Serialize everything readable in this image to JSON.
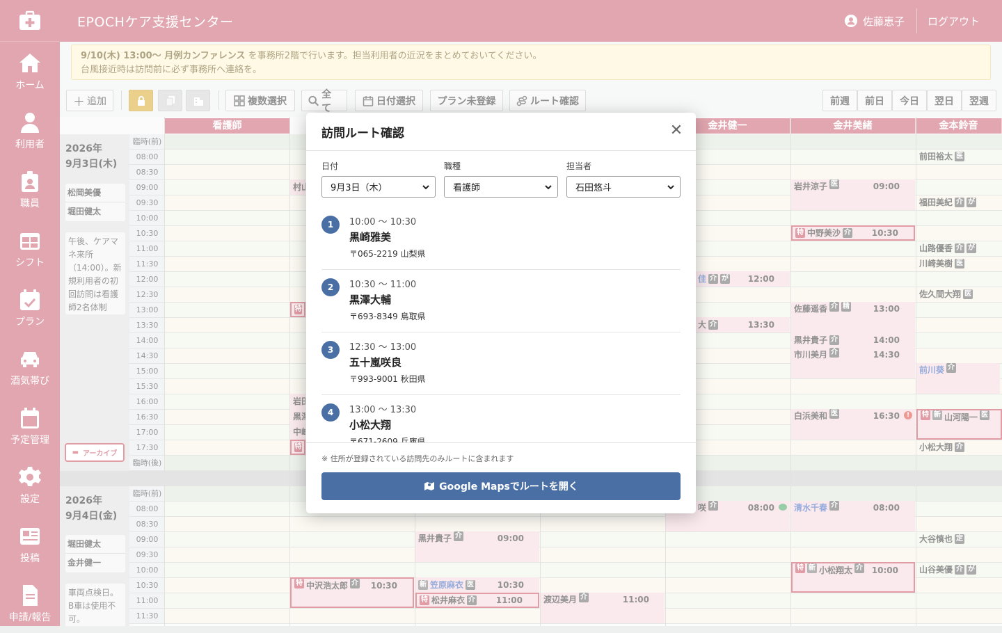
{
  "app": {
    "title": "EPOCHケア支援センター",
    "user": "佐藤恵子",
    "logout": "ログアウト"
  },
  "nav": [
    {
      "label": "ホーム",
      "icon": "home-icon"
    },
    {
      "label": "利用者",
      "icon": "person-icon"
    },
    {
      "label": "職員",
      "icon": "badge-icon"
    },
    {
      "label": "シフト",
      "icon": "table-icon"
    },
    {
      "label": "プラン",
      "icon": "calendar-check-icon"
    },
    {
      "label": "酒気帯び",
      "icon": "car-icon"
    },
    {
      "label": "予定管理",
      "icon": "calendar-icon"
    },
    {
      "label": "設定",
      "icon": "gear-icon"
    },
    {
      "label": "投稿",
      "icon": "newspaper-icon"
    },
    {
      "label": "申請/報告",
      "icon": "document-icon"
    }
  ],
  "notice": {
    "bold": "9/10(木) 13:00〜 月例カンファレンス",
    "line1": "を事務所2階で行います。担当利用者の近況をまとめておいてください。",
    "line2": "台風接近時は訪問前に必ず事務所へ連絡を。"
  },
  "toolbar": {
    "add": "追加",
    "multi_select": "複数選択",
    "all": "全て",
    "date_select": "日付選択",
    "plan_unregistered": "プラン未登録",
    "route_check": "ルート確認",
    "prev_week": "前週",
    "prev_day": "前日",
    "today": "今日",
    "next_day": "翌日",
    "next_week": "翌週"
  },
  "schedule": {
    "columns": [
      "看護師",
      "金井健一",
      "金井美緒",
      "金本鈴音"
    ],
    "day1": {
      "date_line1": "2026年",
      "date_line2": "9月3日(木)",
      "staff": [
        "松岡美優",
        "堀田健太"
      ],
      "memo": "午後、ケアマネ来所（14:00）。新規利用者の初回訪問は看護師2名体制",
      "archive": "アーカイブ",
      "times": [
        "臨時(前)",
        "08:00",
        "08:30",
        "09:00",
        "09:30",
        "10:00",
        "10:30",
        "11:00",
        "11:30",
        "12:00",
        "12:30",
        "13:00",
        "13:30",
        "14:00",
        "14:30",
        "15:00",
        "15:30",
        "16:00",
        "16:30",
        "17:00",
        "17:30",
        "臨時(後)"
      ]
    },
    "day2": {
      "date_line1": "2026年",
      "date_line2": "9月4日(金)",
      "staff": [
        "堀田健太",
        "金井健一"
      ],
      "memo": "車両点検日。B車は使用不可。",
      "times": [
        "臨時(前)",
        "08:00",
        "08:30",
        "09:00",
        "09:30",
        "10:00",
        "10:30",
        "11:00",
        "11:30"
      ]
    },
    "appointments": [
      {
        "name": "前田裕太",
        "tag": "医",
        "time": ""
      },
      {
        "name": "村山",
        "tag": "",
        "time": ""
      },
      {
        "name": "岩井涼子",
        "tag": "医",
        "time": "09:00"
      },
      {
        "name": "福田美紀",
        "tag": "介",
        "tag2": "が",
        "time": ""
      },
      {
        "name": "中野美沙",
        "tag": "介",
        "time": "10:30",
        "flag": "特"
      },
      {
        "name": "山路優香",
        "tag": "介",
        "tag2": "が",
        "time": ""
      },
      {
        "name": "川崎美樹",
        "tag": "医",
        "time": ""
      },
      {
        "name": "佳",
        "tag": "介",
        "tag2": "が",
        "time": "12:00"
      },
      {
        "name": "佐久間大翔",
        "tag": "医",
        "time": ""
      },
      {
        "name": "佐藤遥香",
        "tag": "介",
        "tag2": "精",
        "time": "13:00"
      },
      {
        "name": "大",
        "tag": "介",
        "time": "13:30"
      },
      {
        "name": "黒井貴子",
        "tag": "介",
        "time": "14:00"
      },
      {
        "name": "市川美月",
        "tag": "介",
        "time": "14:30"
      },
      {
        "name": "前川葵",
        "tag": "介",
        "time": ""
      },
      {
        "name": "岩田",
        "tag": "",
        "time": ""
      },
      {
        "name": "黒澤",
        "tag": "",
        "time": ""
      },
      {
        "name": "白浜美和",
        "tag": "医",
        "time": "16:30"
      },
      {
        "name": "山河陽一",
        "tag": "医",
        "time": "",
        "flag": "特",
        "flag2": "新"
      },
      {
        "name": "中峰",
        "tag": "",
        "time": ""
      },
      {
        "name": "小松大翔",
        "tag": "介",
        "time": ""
      },
      {
        "name": "咲",
        "tag": "介",
        "time": "08:00"
      },
      {
        "name": "清水千春",
        "tag": "介",
        "time": "08:00"
      },
      {
        "name": "黒井貴子",
        "tag": "介",
        "time": "09:00"
      },
      {
        "name": "大谷慎也",
        "tag": "定",
        "time": ""
      },
      {
        "name": "小松翔太",
        "tag": "介",
        "time": "10:00",
        "flag": "特",
        "flag2": "新"
      },
      {
        "name": "山谷美優",
        "tag": "介",
        "tag2": "が",
        "time": ""
      },
      {
        "name": "中沢浩太郎",
        "tag": "介",
        "time": "10:30",
        "flag": "特"
      },
      {
        "name": "笠原麻衣",
        "tag": "医",
        "time": "10:30",
        "flag": "新"
      },
      {
        "name": "松井麻衣",
        "tag": "介",
        "time": "11:00",
        "flag": "特"
      },
      {
        "name": "渡辺美月",
        "tag": "介",
        "time": "11:00"
      }
    ]
  },
  "modal": {
    "title": "訪問ルート確認",
    "date_label": "日付",
    "date_value": "9月3日（木）",
    "job_label": "職種",
    "job_value": "看護師",
    "staff_label": "担当者",
    "staff_value": "石田悠斗",
    "routes": [
      {
        "num": "1",
        "time": "10:00 〜 10:30",
        "name": "黒崎雅美",
        "address": "〒065-2219 山梨県"
      },
      {
        "num": "2",
        "time": "10:30 〜 11:00",
        "name": "黒澤大輔",
        "address": "〒693-8349 鳥取県"
      },
      {
        "num": "3",
        "time": "12:30 〜 13:00",
        "name": "五十嵐咲良",
        "address": "〒993-9001 秋田県"
      },
      {
        "num": "4",
        "time": "13:00 〜 13:30",
        "name": "小松大翔",
        "address": "〒671-2609 兵庫県"
      }
    ],
    "note": "※ 住所が登録されている訪問先のみルートに含まれます",
    "gmaps_button": "Google Mapsでルートを開く"
  }
}
